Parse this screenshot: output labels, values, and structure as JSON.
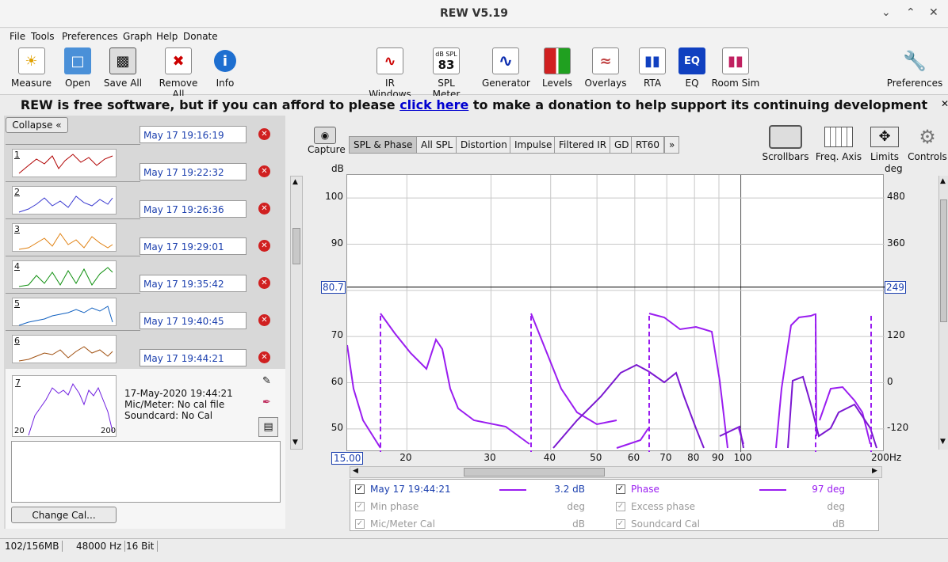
{
  "window": {
    "title": "REW V5.19"
  },
  "menu": [
    "File",
    "Tools",
    "Preferences",
    "Graph",
    "Help",
    "Donate"
  ],
  "toolbar": {
    "measure": "Measure",
    "open": "Open",
    "save_all": "Save All",
    "remove_all": "Remove All",
    "info": "Info",
    "ir_windows": "IR Windows",
    "spl_meter": "SPL Meter",
    "spl_db": "dB SPL",
    "spl_value": "83",
    "generator": "Generator",
    "levels": "Levels",
    "overlays": "Overlays",
    "rta": "RTA",
    "eq": "EQ",
    "eq_icon": "EQ",
    "room_sim": "Room Sim",
    "preferences": "Preferences"
  },
  "donate": {
    "before": "REW is free software, but if you can afford to please ",
    "link": "click here",
    "after": " to make a donation to help support its continuing development"
  },
  "left": {
    "collapse": "Collapse",
    "top_field": "May 17 19:16:19",
    "measurements": [
      {
        "num": "1",
        "date": "May 17 19:22:32",
        "color": "#b00000"
      },
      {
        "num": "2",
        "date": "May 17 19:26:36",
        "color": "#3a3ad0"
      },
      {
        "num": "3",
        "date": "May 17 19:29:01",
        "color": "#e08010"
      },
      {
        "num": "4",
        "date": "May 17 19:35:42",
        "color": "#109010"
      },
      {
        "num": "5",
        "date": "May 17 19:40:45",
        "color": "#1060c0"
      },
      {
        "num": "6",
        "date": "May 17 19:44:21",
        "color": "#a05010"
      }
    ],
    "selected": {
      "num": "7",
      "datetime": "17-May-2020 19:44:21",
      "mic": "Mic/Meter: No cal file",
      "soundcard": "Soundcard: No Cal",
      "range_lo": "20",
      "range_hi": "200"
    },
    "change_cal": "Change Cal..."
  },
  "graph": {
    "capture": "Capture",
    "tabs": [
      "SPL & Phase",
      "All SPL",
      "Distortion",
      "Impulse",
      "Filtered IR",
      "GD",
      "RT60",
      "»"
    ],
    "scrollbars": "Scrollbars",
    "freq_axis": "Freq. Axis",
    "limits": "Limits",
    "controls": "Controls",
    "left_unit": "dB",
    "right_unit": "deg",
    "y_left": [
      "100",
      "90",
      "70",
      "60",
      "50"
    ],
    "y_right": [
      "480",
      "360",
      "120",
      "0",
      "-120"
    ],
    "cursor_left": "80.7",
    "cursor_right": "249",
    "x_start": "15.00",
    "x_ticks": [
      "20",
      "30",
      "40",
      "50",
      "60",
      "70",
      "80",
      "90",
      "100",
      "200Hz"
    ]
  },
  "legend": {
    "r1_name": "May 17 19:44:21",
    "r1_val": "3.2 dB",
    "r1b_name": "Phase",
    "r1b_val": "97 deg",
    "r2_name": "Min phase",
    "r2_unit": "deg",
    "r2b_name": "Excess phase",
    "r2b_unit": "deg",
    "r3_name": "Mic/Meter Cal",
    "r3_unit": "dB",
    "r3b_name": "Soundcard Cal",
    "r3b_unit": "dB"
  },
  "status": {
    "memory": "102/156MB",
    "rate": "48000 Hz",
    "bits": "16 Bit"
  },
  "chart_data": {
    "type": "line",
    "x_scale": "log",
    "xlim": [
      15,
      200
    ],
    "ylim_left": [
      45,
      105
    ],
    "ylim_right": [
      -180,
      540
    ],
    "cursor_y": 80.7,
    "series": [
      {
        "name": "Phase",
        "color": "#9a1df0",
        "axis": "right"
      }
    ]
  }
}
